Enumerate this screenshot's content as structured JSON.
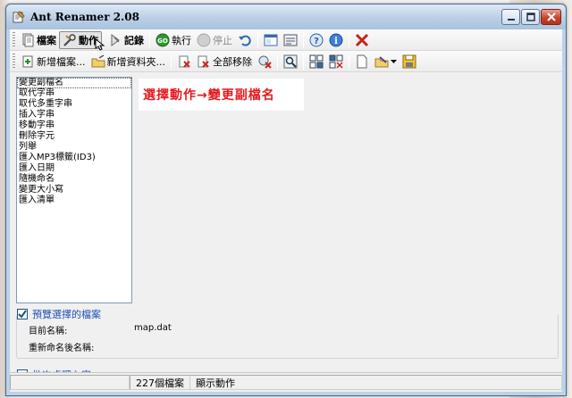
{
  "window": {
    "title": "Ant Renamer 2.08",
    "buttons": {
      "minimize": "_",
      "maximize": "□",
      "close": "X"
    }
  },
  "toolbar_main": {
    "files_label": "檔案",
    "actions_label": "動作",
    "log_label": "記錄",
    "go_label": "執行",
    "stop_label": "停止"
  },
  "toolbar_files": {
    "add_files_label": "新增檔案...",
    "add_folder_label": "新增資料夾...",
    "remove_all_label": "全部移除"
  },
  "action_list": [
    "變更副檔名",
    "取代字串",
    "取代多重字串",
    "插入字串",
    "移動字串",
    "刪除字元",
    "列舉",
    "匯入MP3標籤(ID3)",
    "匯入日期",
    "隨機命名",
    "變更大小寫",
    "匯入清單"
  ],
  "annotation_text": "選擇動作→變更副檔名",
  "preview_group": {
    "title": "預覽選擇的檔案",
    "checked": true,
    "current_name_label": "目前名稱:",
    "current_name_value": "map.dat",
    "new_name_label": "重新命名後名稱:",
    "new_name_value": ""
  },
  "batch_group": {
    "title": "批次處理內容",
    "checked": false
  },
  "statusbar": {
    "file_count": "227個檔案",
    "mode": "顯示動作"
  },
  "colors": {
    "annotation_red": "#e4191f",
    "group_title_blue": "#1d52b8",
    "titlebar_blue": "#bcd2e8"
  }
}
